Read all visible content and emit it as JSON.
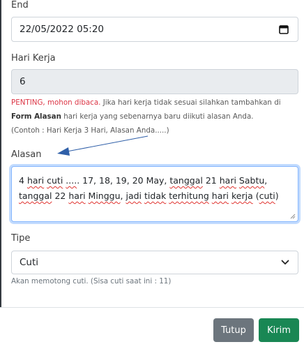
{
  "end": {
    "label": "End",
    "value": "22/05/2022 05:20",
    "icon": "calendar-icon"
  },
  "hari_kerja": {
    "label": "Hari Kerja",
    "value": "6"
  },
  "note": {
    "important": "PENTING, mohon dibaca.",
    "text1": " Jika hari kerja tidak sesuai silahkan tambahkan di ",
    "bold": "Form Alasan",
    "text2": " hari kerja yang sebenarnya baru diikuti alasan Anda.",
    "example": "(Contoh : Hari Kerja 3 Hari, Alasan Anda.....)"
  },
  "alasan": {
    "label": "Alasan",
    "line1_parts": [
      "4 ",
      "hari",
      " ",
      "cuti",
      " ",
      "....",
      ". 17, 18, 19, 20 May,  ",
      "tanggal",
      " 21 ",
      "hari",
      " ",
      "Sabtu",
      ","
    ],
    "line2_parts": [
      "tanggal",
      " 22 ",
      "hari",
      " ",
      "Minggu",
      ", ",
      "jadi",
      " ",
      "tidak",
      " ",
      "terhitung",
      " ",
      "hari",
      " ",
      "kerja",
      " (",
      "cuti",
      ")"
    ]
  },
  "tipe": {
    "label": "Tipe",
    "selected": "Cuti",
    "help": "Akan memotong cuti. (Sisa cuti saat ini : 11)"
  },
  "footer": {
    "close_label": "Tutup",
    "submit_label": "Kirim"
  },
  "colors": {
    "accent_red": "#dc3545",
    "btn_secondary": "#6c757d",
    "btn_success": "#198754",
    "focus_border": "#86b7fe",
    "annotation_arrow": "#2f5fa8"
  }
}
